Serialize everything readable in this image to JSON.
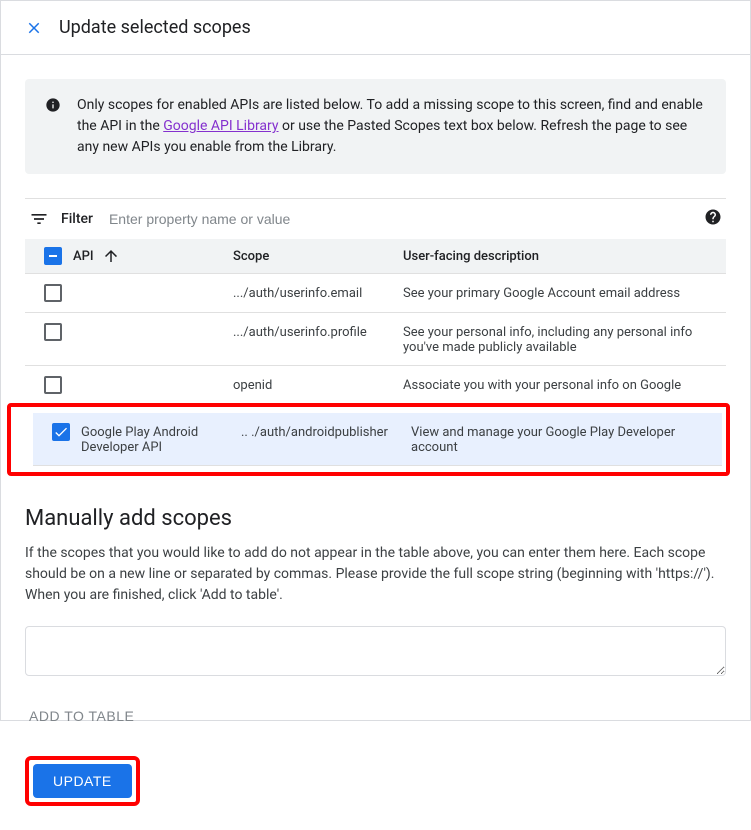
{
  "header": {
    "title": "Update selected scopes"
  },
  "info": {
    "text_before": "Only scopes for enabled APIs are listed below. To add a missing scope to this screen, find and enable the API in the ",
    "link_text": "Google API Library",
    "text_after": " or use the Pasted Scopes text box below. Refresh the page to see any new APIs you enable from the Library."
  },
  "filter": {
    "label": "Filter",
    "placeholder": "Enter property name or value"
  },
  "table": {
    "headers": {
      "api": "API",
      "scope": "Scope",
      "desc": "User-facing description"
    },
    "rows": [
      {
        "checked": false,
        "api": "",
        "scope": ".../auth/userinfo.email",
        "desc": "See your primary Google Account email address"
      },
      {
        "checked": false,
        "api": "",
        "scope": ".../auth/userinfo.profile",
        "desc": "See your personal info, including any personal info you've made publicly available"
      },
      {
        "checked": false,
        "api": "",
        "scope": "openid",
        "desc": "Associate you with your personal info on Google"
      },
      {
        "checked": true,
        "api": "Google Play Android Developer API",
        "scope": ".. ./auth/androidpublisher",
        "desc": "View and manage your Google Play Developer account"
      }
    ]
  },
  "manual": {
    "title": "Manually add scopes",
    "description": "If the scopes that you would like to add do not appear in the table above, you can enter them here. Each scope should be on a new line or separated by commas. Please provide the full scope string (beginning with 'https://'). When you are finished, click 'Add to table'.",
    "add_button": "ADD TO TABLE"
  },
  "footer": {
    "update_button": "UPDATE"
  }
}
